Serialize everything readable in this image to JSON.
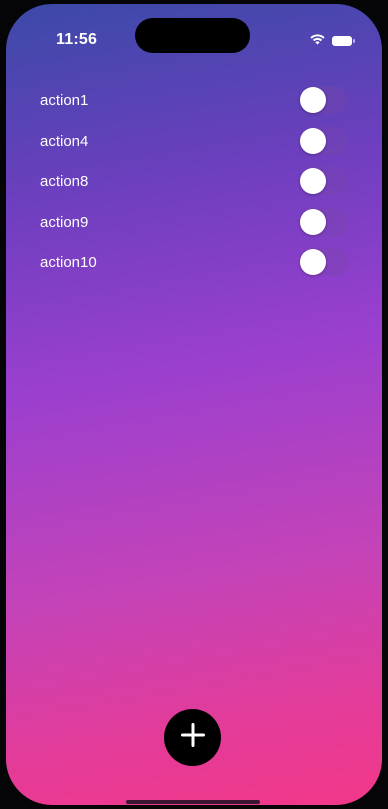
{
  "status_bar": {
    "time": "11:56",
    "icons": [
      "wifi-icon",
      "battery-icon"
    ]
  },
  "actions": {
    "items": [
      {
        "label": "action1",
        "enabled": false
      },
      {
        "label": "action4",
        "enabled": false
      },
      {
        "label": "action8",
        "enabled": false
      },
      {
        "label": "action9",
        "enabled": false
      },
      {
        "label": "action10",
        "enabled": false
      }
    ]
  },
  "fab": {
    "icon": "plus-icon"
  },
  "colors": {
    "gradient_top": "#3b4aa8",
    "gradient_mid": "#9a3fcf",
    "gradient_bottom": "#f2388a",
    "fab_background": "#000000",
    "toggle_knob": "#ffffff"
  }
}
